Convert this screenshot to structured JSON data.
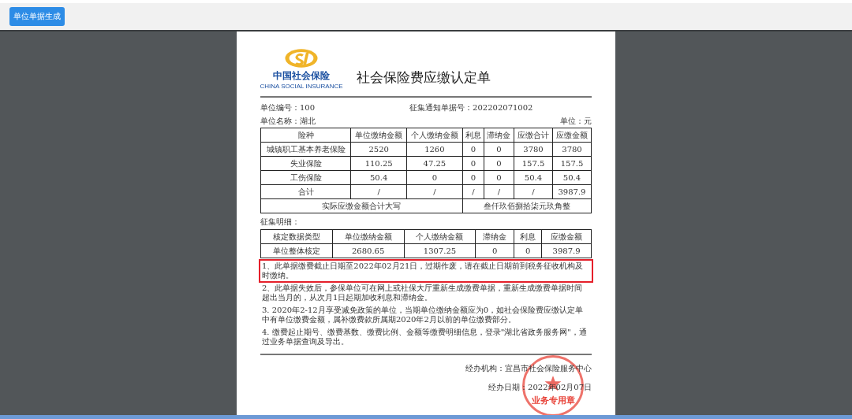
{
  "toolbar": {
    "button": "单位单据生成"
  },
  "document": {
    "logo": {
      "cn": "中国社会保险",
      "en": "CHINA SOCIAL INSURANCE"
    },
    "title": "社会保险费应缴认定单",
    "unit_no": "单位编号：100",
    "notice_no": "征集通知单据号：202202071002",
    "unit_name": "单位名称：湖北",
    "unit": "单位：元",
    "table": {
      "columns": [
        "险种",
        "单位缴纳金额",
        "个人缴纳金额",
        "利息",
        "滞纳金",
        "应缴合计",
        "应缴金额"
      ],
      "rows": [
        [
          "城镇职工基本养老保险",
          "2520",
          "1260",
          "0",
          "0",
          "3780",
          "3780"
        ],
        [
          "失业保险",
          "110.25",
          "47.25",
          "0",
          "0",
          "157.5",
          "157.5"
        ],
        [
          "工伤保险",
          "50.4",
          "0",
          "0",
          "0",
          "50.4",
          "50.4"
        ],
        [
          "合计",
          "/",
          "/",
          "/",
          "/",
          "/",
          "3987.9"
        ]
      ],
      "total_label": "实际应缴金额合计大写",
      "total_value": "叁仟玖佰捌拾柒元玖角整"
    },
    "detail_label": "征集明细：",
    "detail": {
      "columns": [
        "核定数据类型",
        "单位缴纳金额",
        "个人缴纳金额",
        "滞纳金",
        "利息",
        "应缴金额"
      ],
      "rows": [
        [
          "单位整体核定",
          "2680.65",
          "1307.25",
          "0",
          "0",
          "3987.9"
        ]
      ]
    },
    "notes": [
      {
        "text": "1、此单据缴费截止日期至2022年02月21日，过期作废，请在截止日期前到税务征收机构及时缴纳。",
        "highlighted": true
      },
      {
        "text": "2、此单据失效后，参保单位可在网上或社保大厅重新生成缴费单据，重新生成缴费单据时间超出当月的，从次月1日起期加收利息和滞纳金。",
        "highlighted": false
      },
      {
        "text": "3. 2020年2-12月享受减免政策的单位，当期单位缴纳金额应为0，如社会保险费应缴认定单中有单位缴费金额，属补缴费款所属期2020年2月以前的单位缴费部分。",
        "highlighted": false
      },
      {
        "text": "4. 缴费起止期号、缴费基数、缴费比例、金额等缴费明细信息，登录\"湖北省政务服务网\"，通过业务单据查询及导出。",
        "highlighted": false
      }
    ],
    "agency": "经办机构：宜昌市社会保险服务中心",
    "date": "经办日期：2022年02月07日",
    "stamp": "业务专用章"
  }
}
